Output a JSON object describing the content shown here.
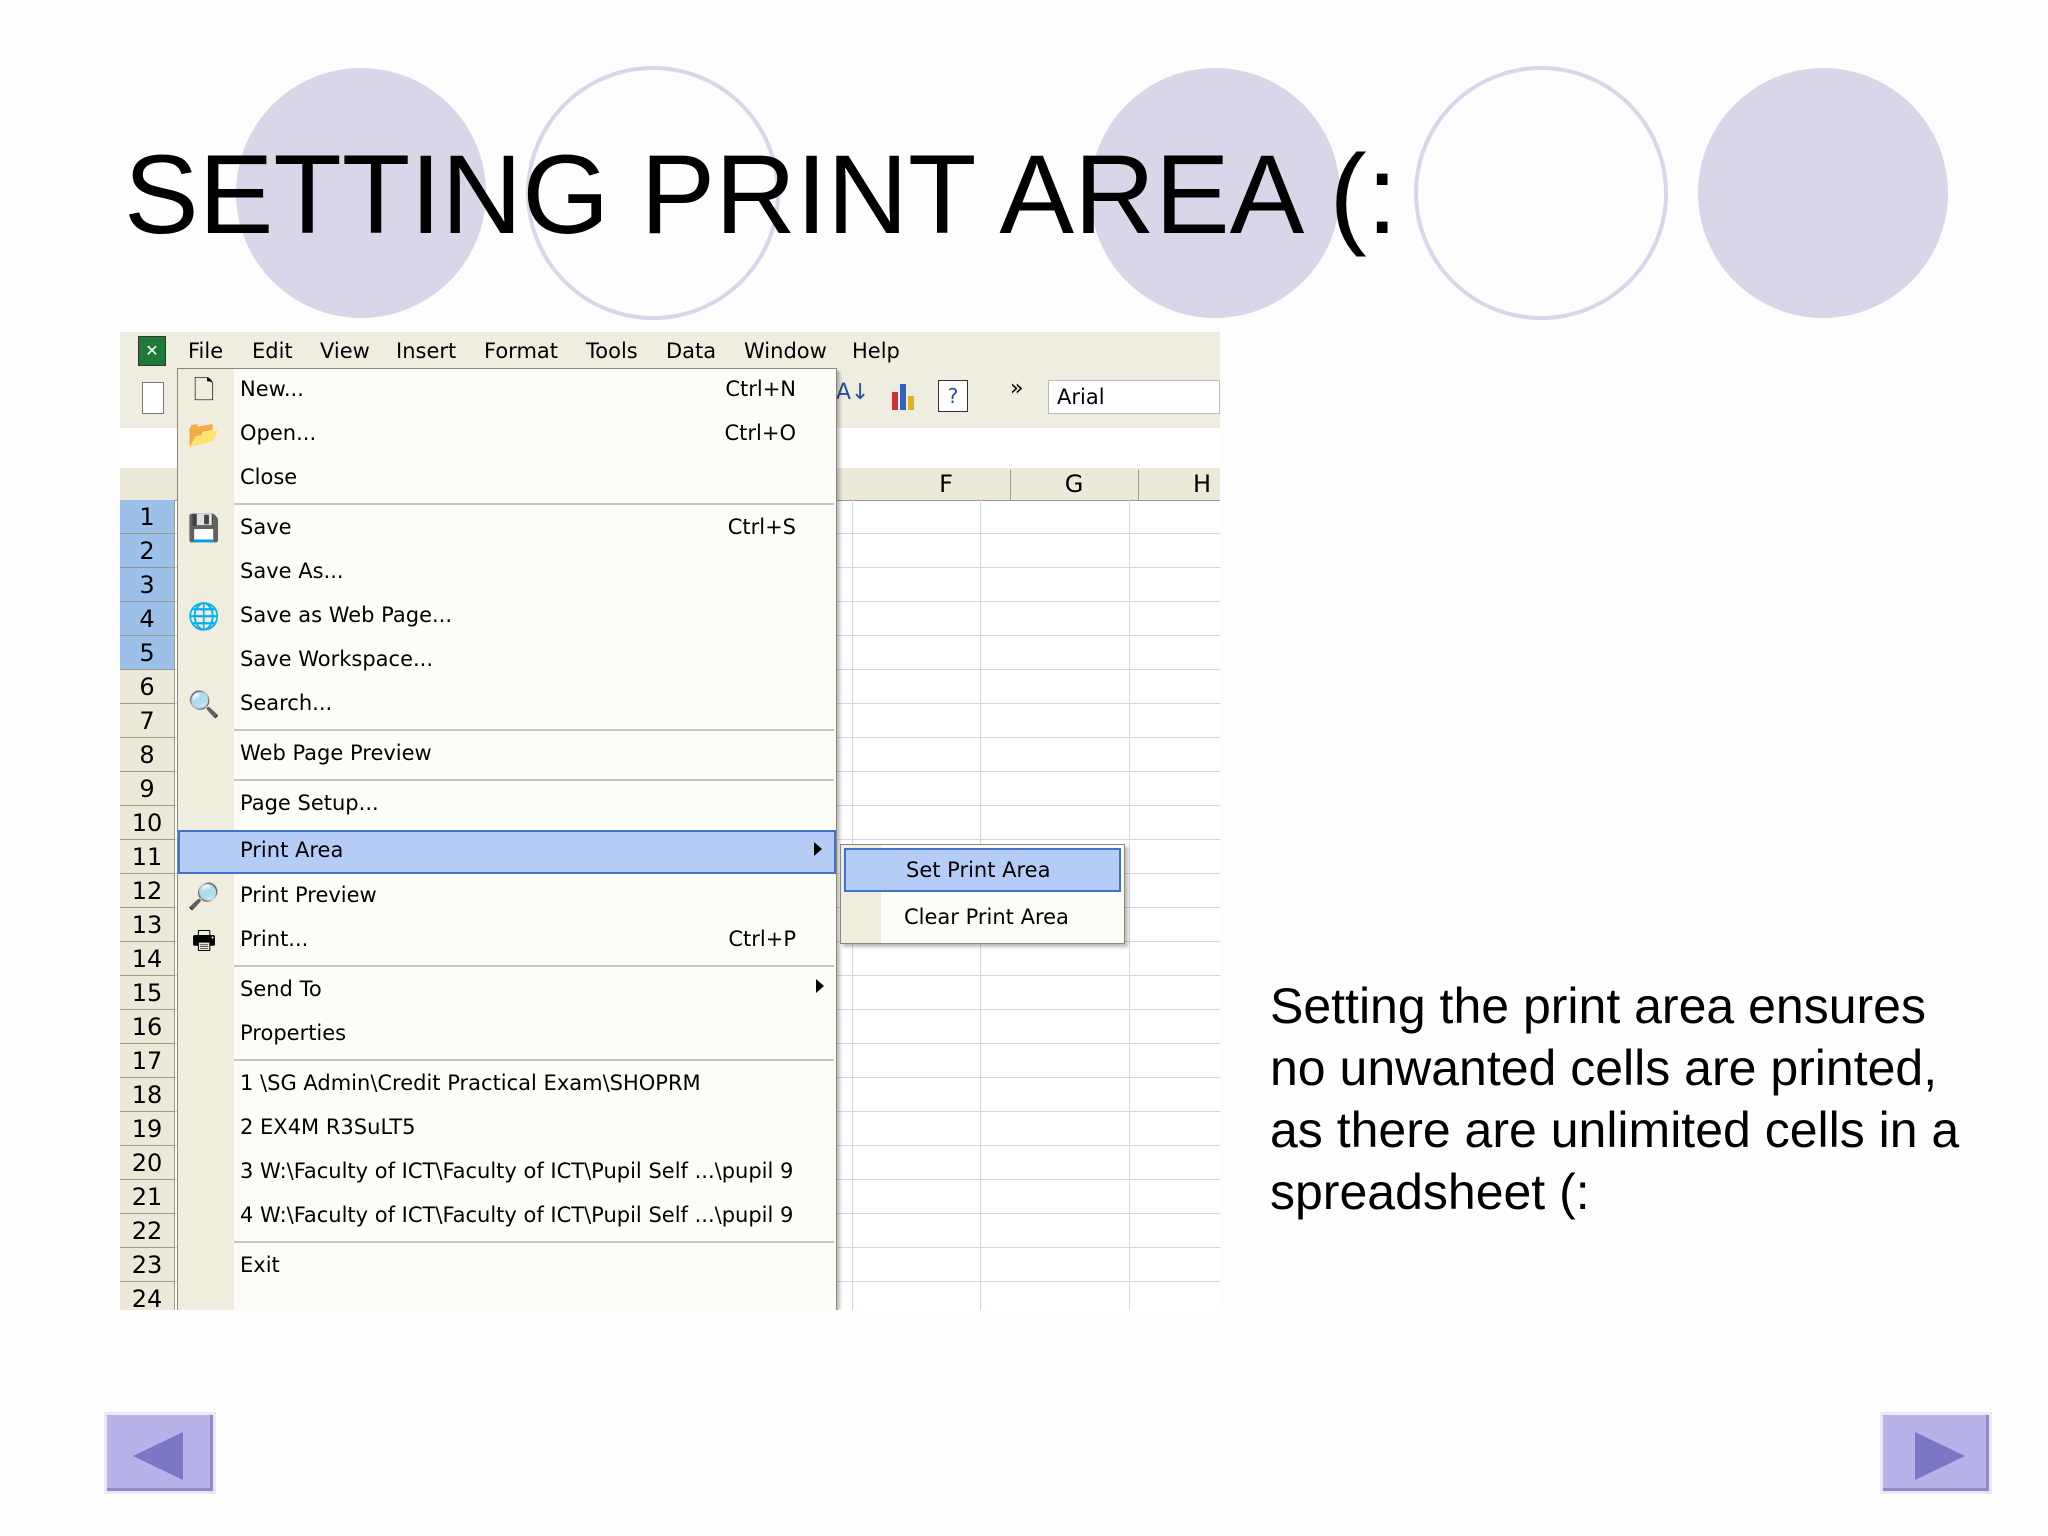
{
  "slide": {
    "title": "SETTING PRINT AREA (:",
    "body": "Setting the print area ensures no unwanted cells are printed, as there are unlimited cells in a spreadsheet (:"
  },
  "menubar": [
    "File",
    "Edit",
    "View",
    "Insert",
    "Format",
    "Tools",
    "Data",
    "Window",
    "Help"
  ],
  "toolbar": {
    "font_name": "Arial",
    "overflow": "»"
  },
  "columns": [
    "F",
    "G",
    "H"
  ],
  "rows": [
    "1",
    "2",
    "3",
    "4",
    "5",
    "6",
    "7",
    "8",
    "9",
    "10",
    "11",
    "12",
    "13",
    "14",
    "15",
    "16",
    "17",
    "18",
    "19",
    "20",
    "21",
    "22",
    "23",
    "24"
  ],
  "file_menu": {
    "new": {
      "label": "New...",
      "shortcut": "Ctrl+N"
    },
    "open": {
      "label": "Open...",
      "shortcut": "Ctrl+O"
    },
    "close": {
      "label": "Close"
    },
    "save": {
      "label": "Save",
      "shortcut": "Ctrl+S"
    },
    "save_as": {
      "label": "Save As..."
    },
    "save_web": {
      "label": "Save as Web Page..."
    },
    "save_workspace": {
      "label": "Save Workspace..."
    },
    "search": {
      "label": "Search..."
    },
    "web_preview": {
      "label": "Web Page Preview"
    },
    "page_setup": {
      "label": "Page Setup..."
    },
    "print_area": {
      "label": "Print Area"
    },
    "print_preview": {
      "label": "Print Preview"
    },
    "print": {
      "label": "Print...",
      "shortcut": "Ctrl+P"
    },
    "send_to": {
      "label": "Send To"
    },
    "properties": {
      "label": "Properties"
    },
    "recent1": {
      "label": "1 \\SG Admin\\Credit Practical Exam\\SHOPRM"
    },
    "recent2": {
      "label": "2 EX4M R3SuLT5"
    },
    "recent3": {
      "label": "3 W:\\Faculty of ICT\\Faculty of ICT\\Pupil Self ...\\pupil 9"
    },
    "recent4": {
      "label": "4 W:\\Faculty of ICT\\Faculty of ICT\\Pupil Self ...\\pupil 9"
    },
    "exit": {
      "label": "Exit"
    }
  },
  "print_area_submenu": {
    "set": "Set Print Area",
    "clear": "Clear Print Area"
  },
  "colors": {
    "accent_circle": "#d9d6ea",
    "menu_highlight": "#b5cdf6",
    "nav_button": "#b7b3e8"
  }
}
